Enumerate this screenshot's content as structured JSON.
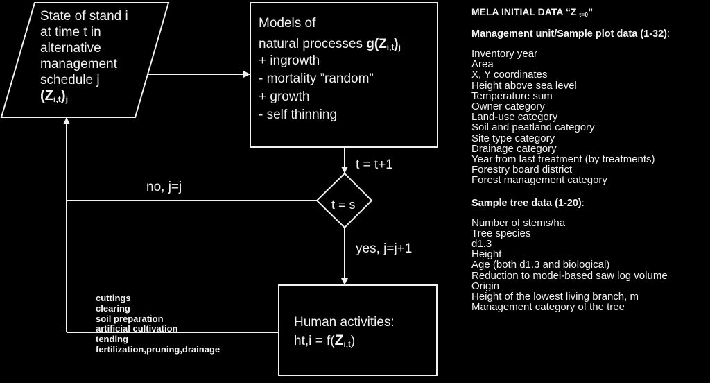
{
  "diagram": {
    "state_box": {
      "lines": [
        "State of stand i",
        "at time t in",
        "alternative",
        "management",
        "schedule j"
      ],
      "formula_main": "(Z",
      "formula_sub": "i,t",
      "formula_close": ")",
      "formula_outer_sub": "j"
    },
    "models_box": {
      "title": "Models of",
      "line2_text": "natural processes ",
      "line2_formula": "g(Z",
      "line2_sub": "i,t",
      "line2_close": ")",
      "line2_outer_sub": "j",
      "items": [
        "+ ingrowth",
        "- mortality ”random”",
        "+ growth",
        "- self thinning"
      ]
    },
    "edge_labels": {
      "increment": "t = t+1",
      "no_branch": "no, j=j",
      "yes_branch": "yes, j=j+1"
    },
    "decision": {
      "label": "t = s"
    },
    "human_box": {
      "title": "Human activities:",
      "formula_prefix": "ht,i = f(",
      "formula_bold": "Z",
      "formula_sub": "i,t",
      "formula_close": ")"
    },
    "activities": [
      "cuttings",
      "clearing",
      "soil preparation",
      "artificial cultivation",
      "tending",
      "fertilization,pruning,drainage"
    ]
  },
  "initial_data": {
    "title": "MELA INITIAL DATA “Z ",
    "title_sub": "t=0",
    "title_close": "”",
    "management_unit": {
      "heading": "Management unit/Sample plot data (1-32)",
      "heading_suffix": ":",
      "items": [
        "Inventory year",
        "Area",
        "X, Y coordinates",
        "Height above sea level",
        "Temperature sum",
        "Owner category",
        "Land-use category",
        "Soil and peatland  category",
        "Site type category",
        "Drainage category",
        "Year from last treatment (by treatments)",
        "Forestry board district",
        "Forest management  category"
      ]
    },
    "sample_tree": {
      "heading": "Sample tree data (1-20)",
      "heading_suffix": ":",
      "items": [
        "Number of stems/ha",
        "Tree species",
        "d1.3",
        "Height",
        "Age (both d1.3 and biological)",
        "Reduction to model-based  saw log volume",
        "Origin",
        "Height of the lowest living  branch, m",
        "Management  category of the tree"
      ]
    }
  }
}
